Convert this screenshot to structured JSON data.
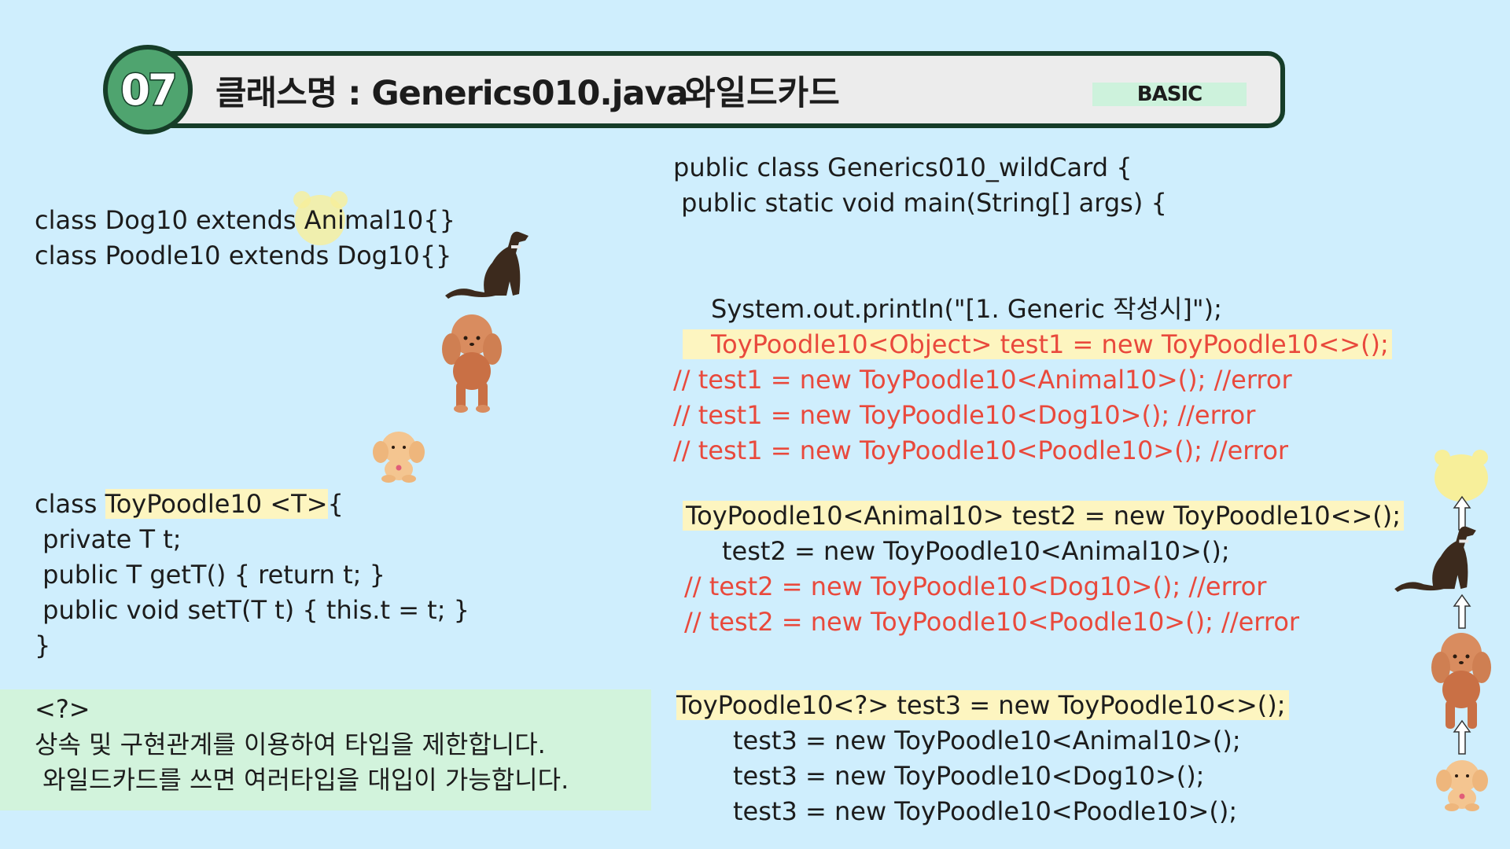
{
  "header": {
    "number": "07",
    "title": "클래스명 : Generics010.java",
    "subtitle": "와일드카드",
    "level": "BASIC"
  },
  "left_code": {
    "line1": "class Dog10 extends Animal10{}",
    "line2": "class Poodle10 extends Dog10{}",
    "toy_line_prefix": "class ",
    "toy_line_highlight": "ToyPoodle10 <T>",
    "toy_line_suffix": "{",
    "line4": " private T t;",
    "line5": " public T getT() { return t; }",
    "line6": " public void setT(T t) { this.t = t; }",
    "line7": "}"
  },
  "note": {
    "line1": "<?>",
    "line2": "상속 및 구현관계를 이용하여 타입을 제한합니다.",
    "line3": " 와일드카드를 쓰면 여러타입을 대입이 가능합니다."
  },
  "right_code": {
    "class_decl": "public class Generics010_wildCard {",
    "main_decl": " public static void main(String[] args) {",
    "println": "System.out.println(\"[1. Generic 작성시]\");",
    "test1_decl": "ToyPoodle10<Object> test1 = new ToyPoodle10<>();",
    "test1_err1": "// test1 = new ToyPoodle10<Animal10>(); //error",
    "test1_err2": "// test1 = new ToyPoodle10<Dog10>(); //error",
    "test1_err3": "// test1 = new ToyPoodle10<Poodle10>(); //error",
    "test2_decl": "ToyPoodle10<Animal10> test2 = new ToyPoodle10<>();",
    "test2_ok": "test2 = new ToyPoodle10<Animal10>();",
    "test2_err1": "// test2 = new ToyPoodle10<Dog10>(); //error",
    "test2_err2": "// test2 = new ToyPoodle10<Poodle10>(); //error",
    "test3_decl": "ToyPoodle10<?> test3 = new ToyPoodle10<>();",
    "test3_ok1": "test3 = new ToyPoodle10<Animal10>();",
    "test3_ok2": "test3 = new ToyPoodle10<Dog10>();",
    "test3_ok3": "test3 = new ToyPoodle10<Poodle10>();"
  },
  "colors": {
    "background": "#cfeefd",
    "accent_green": "#4fa46f",
    "dark_green": "#163d28",
    "error_red": "#e9493c",
    "highlight_yellow": "#fdf5c0",
    "note_green": "#d2f3dc"
  },
  "icons": [
    "bear-icon",
    "dog-icon",
    "poodle-icon",
    "toy-poodle-icon",
    "up-arrow-icon"
  ]
}
